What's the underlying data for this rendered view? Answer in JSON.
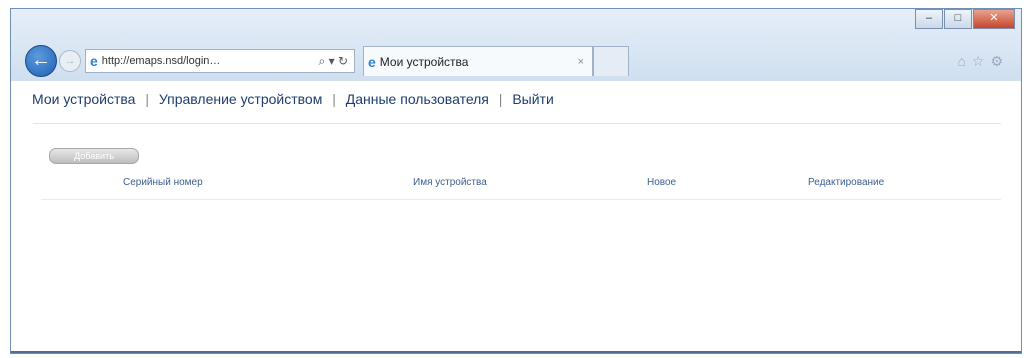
{
  "browser": {
    "url": "http://emaps.nsd/login…",
    "addr_controls": "⌕ ▾ ↻",
    "tab_title": "Мои устройства",
    "tab_close": "×",
    "window_buttons": {
      "minimize": "–",
      "maximize": "□",
      "close": "✕"
    },
    "toolbar_icons": "⌂☆⚙"
  },
  "nav": {
    "items": [
      "Мои устройства",
      "Управление устройством",
      "Данные пользователя",
      "Выйти"
    ],
    "separators": [
      "|",
      "|",
      "|"
    ]
  },
  "page": {
    "add_button_label": "Добавить",
    "table": {
      "headers": [
        "Серийный номер",
        "Имя устройства",
        "Новое",
        "Редактирование"
      ]
    }
  }
}
